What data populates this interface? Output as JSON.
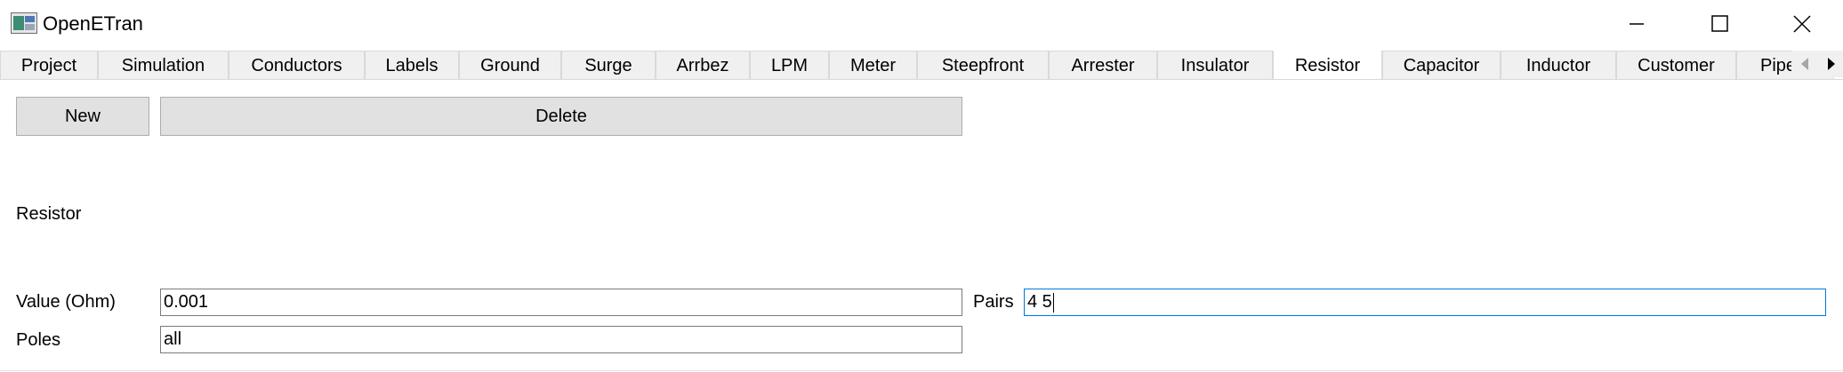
{
  "window": {
    "title": "OpenETran",
    "icon": "openetran-app-icon"
  },
  "tabs": [
    {
      "label": "Project"
    },
    {
      "label": "Simulation"
    },
    {
      "label": "Conductors"
    },
    {
      "label": "Labels"
    },
    {
      "label": "Ground"
    },
    {
      "label": "Surge"
    },
    {
      "label": "Arrbez"
    },
    {
      "label": "LPM"
    },
    {
      "label": "Meter"
    },
    {
      "label": "Steepfront"
    },
    {
      "label": "Arrester"
    },
    {
      "label": "Insulator"
    },
    {
      "label": "Resistor",
      "active": true
    },
    {
      "label": "Capacitor"
    },
    {
      "label": "Inductor"
    },
    {
      "label": "Customer"
    },
    {
      "label": "Pipe"
    }
  ],
  "toolbar": {
    "new_label": "New",
    "delete_label": "Delete"
  },
  "section": {
    "title": "Resistor"
  },
  "form": {
    "value_label": "Value (Ohm)",
    "value": "0.001",
    "pairs_label": "Pairs",
    "pairs": "4 5",
    "poles_label": "Poles",
    "poles": "all"
  },
  "colors": {
    "focus_border": "#0078d7",
    "button_bg": "#e1e1e1",
    "tab_bg": "#f0f0f0"
  }
}
